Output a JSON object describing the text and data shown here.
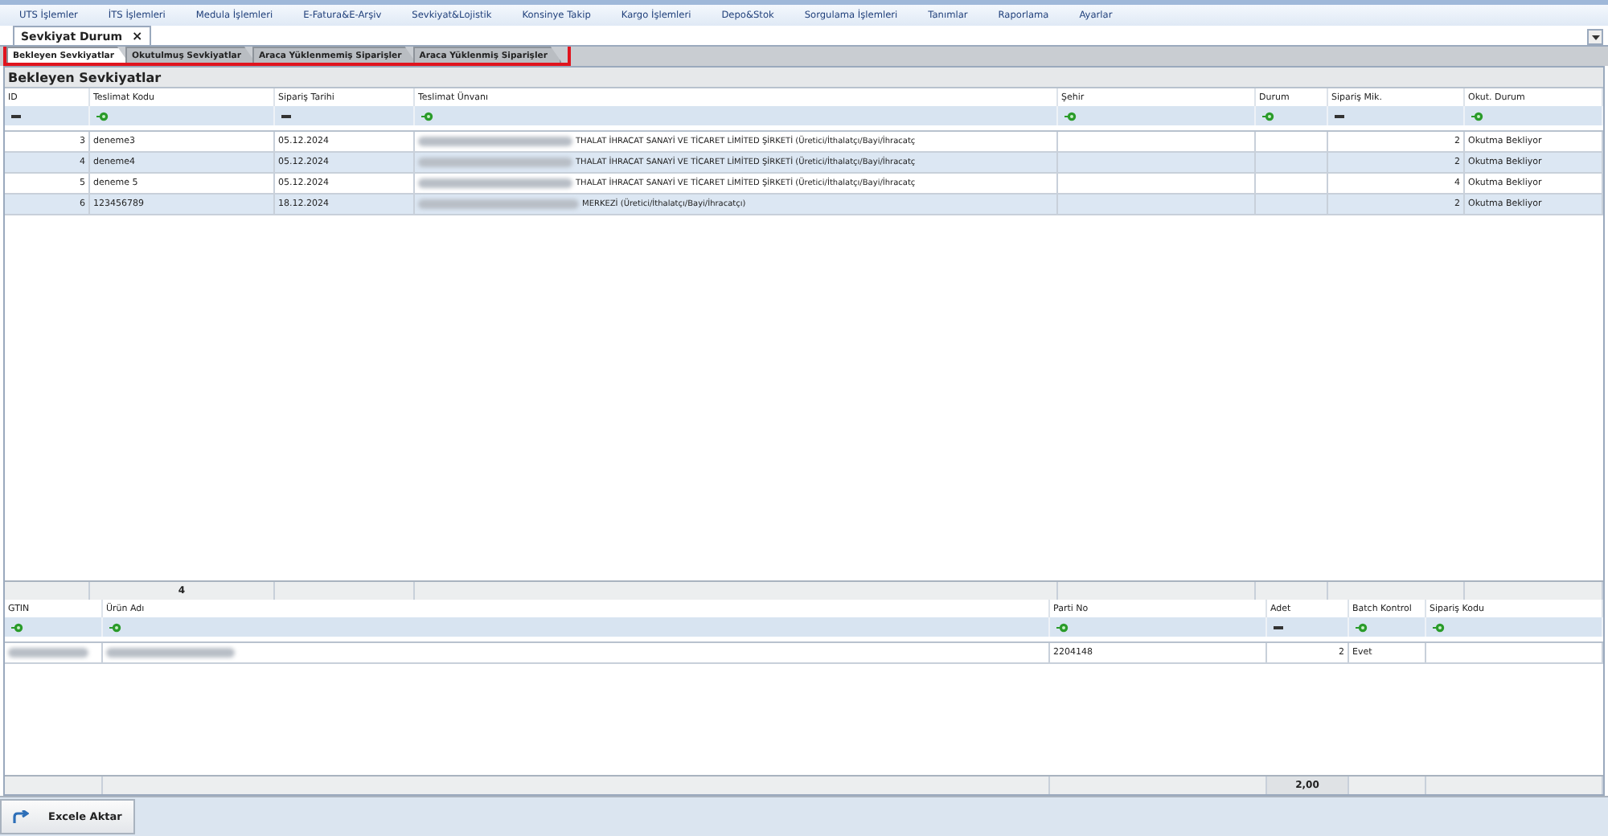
{
  "menu": [
    "UTS İşlemler",
    "İTS İşlemleri",
    "Medula İşlemleri",
    "E-Fatura&E-Arşiv",
    "Sevkiyat&Lojistik",
    "Konsinye Takip",
    "Kargo İşlemleri",
    "Depo&Stok",
    "Sorgulama İşlemleri",
    "Tanımlar",
    "Raporlama",
    "Ayarlar"
  ],
  "document_tab": {
    "title": "Sevkiyat Durum",
    "close": "×"
  },
  "tabs": [
    {
      "label": "Bekleyen Sevkiyatlar",
      "selected": true
    },
    {
      "label": "Okutulmuş Sevkiyatlar",
      "selected": false
    },
    {
      "label": "Araca Yüklenmemiş Siparişler",
      "selected": false
    },
    {
      "label": "Araca Yüklenmiş Siparişler",
      "selected": false
    }
  ],
  "grid": {
    "title": "Bekleyen Sevkiyatlar",
    "columns": [
      {
        "label": "ID",
        "kind": "number"
      },
      {
        "label": "Teslimat Kodu",
        "kind": "text"
      },
      {
        "label": "Sipariş Tarihi",
        "kind": "number"
      },
      {
        "label": "Teslimat Ünvanı",
        "kind": "text"
      },
      {
        "label": "Şehir",
        "kind": "text"
      },
      {
        "label": "Durum",
        "kind": "text"
      },
      {
        "label": "Sipariş Mik.",
        "kind": "number"
      },
      {
        "label": "Okut. Durum",
        "kind": "text"
      }
    ],
    "rows": [
      {
        "cells": [
          "3",
          "deneme3",
          "05.12.2024",
          {
            "redacted": true,
            "text": "THALAT İHRACAT SANAYİ VE TİCARET LİMİTED ŞİRKETİ (Üretici/İthalatçı/Bayi/İhracatç"
          },
          null,
          null,
          "2",
          "Okutma Bekliyor"
        ]
      },
      {
        "cells": [
          "4",
          "deneme4",
          "05.12.2024",
          {
            "redacted": true,
            "text": "THALAT İHRACAT SANAYİ VE TİCARET LİMİTED ŞİRKETİ (Üretici/İthalatçı/Bayi/İhracatç"
          },
          null,
          null,
          "2",
          "Okutma Bekliyor"
        ]
      },
      {
        "cells": [
          "5",
          "deneme 5",
          "05.12.2024",
          {
            "redacted": true,
            "text": "THALAT İHRACAT SANAYİ VE TİCARET LİMİTED ŞİRKETİ (Üretici/İthalatçı/Bayi/İhracatç"
          },
          null,
          null,
          "4",
          "Okutma Bekliyor"
        ]
      },
      {
        "cells": [
          "6",
          "123456789",
          "18.12.2024",
          {
            "redacted": true,
            "text": "MERKEZİ (Üretici/İthalatçı/Bayi/İhracatçı)"
          },
          null,
          null,
          "2",
          "Okutma Bekliyor"
        ]
      }
    ],
    "footer": {
      "count": "4"
    }
  },
  "detail": {
    "columns": [
      {
        "label": "GTIN",
        "kind": "text"
      },
      {
        "label": "Ürün Adı",
        "kind": "text"
      },
      {
        "label": "Parti No",
        "kind": "text"
      },
      {
        "label": "Adet",
        "kind": "number"
      },
      {
        "label": "Batch Kontrol",
        "kind": "text"
      },
      {
        "label": "Sipariş Kodu",
        "kind": "text"
      }
    ],
    "rows": [
      {
        "cells": [
          {
            "redacted": true
          },
          {
            "redacted": true
          },
          "2204148",
          "2",
          "Evet",
          null
        ]
      }
    ],
    "footer": {
      "total": "2,00"
    }
  },
  "export_button": "Excele Aktar"
}
